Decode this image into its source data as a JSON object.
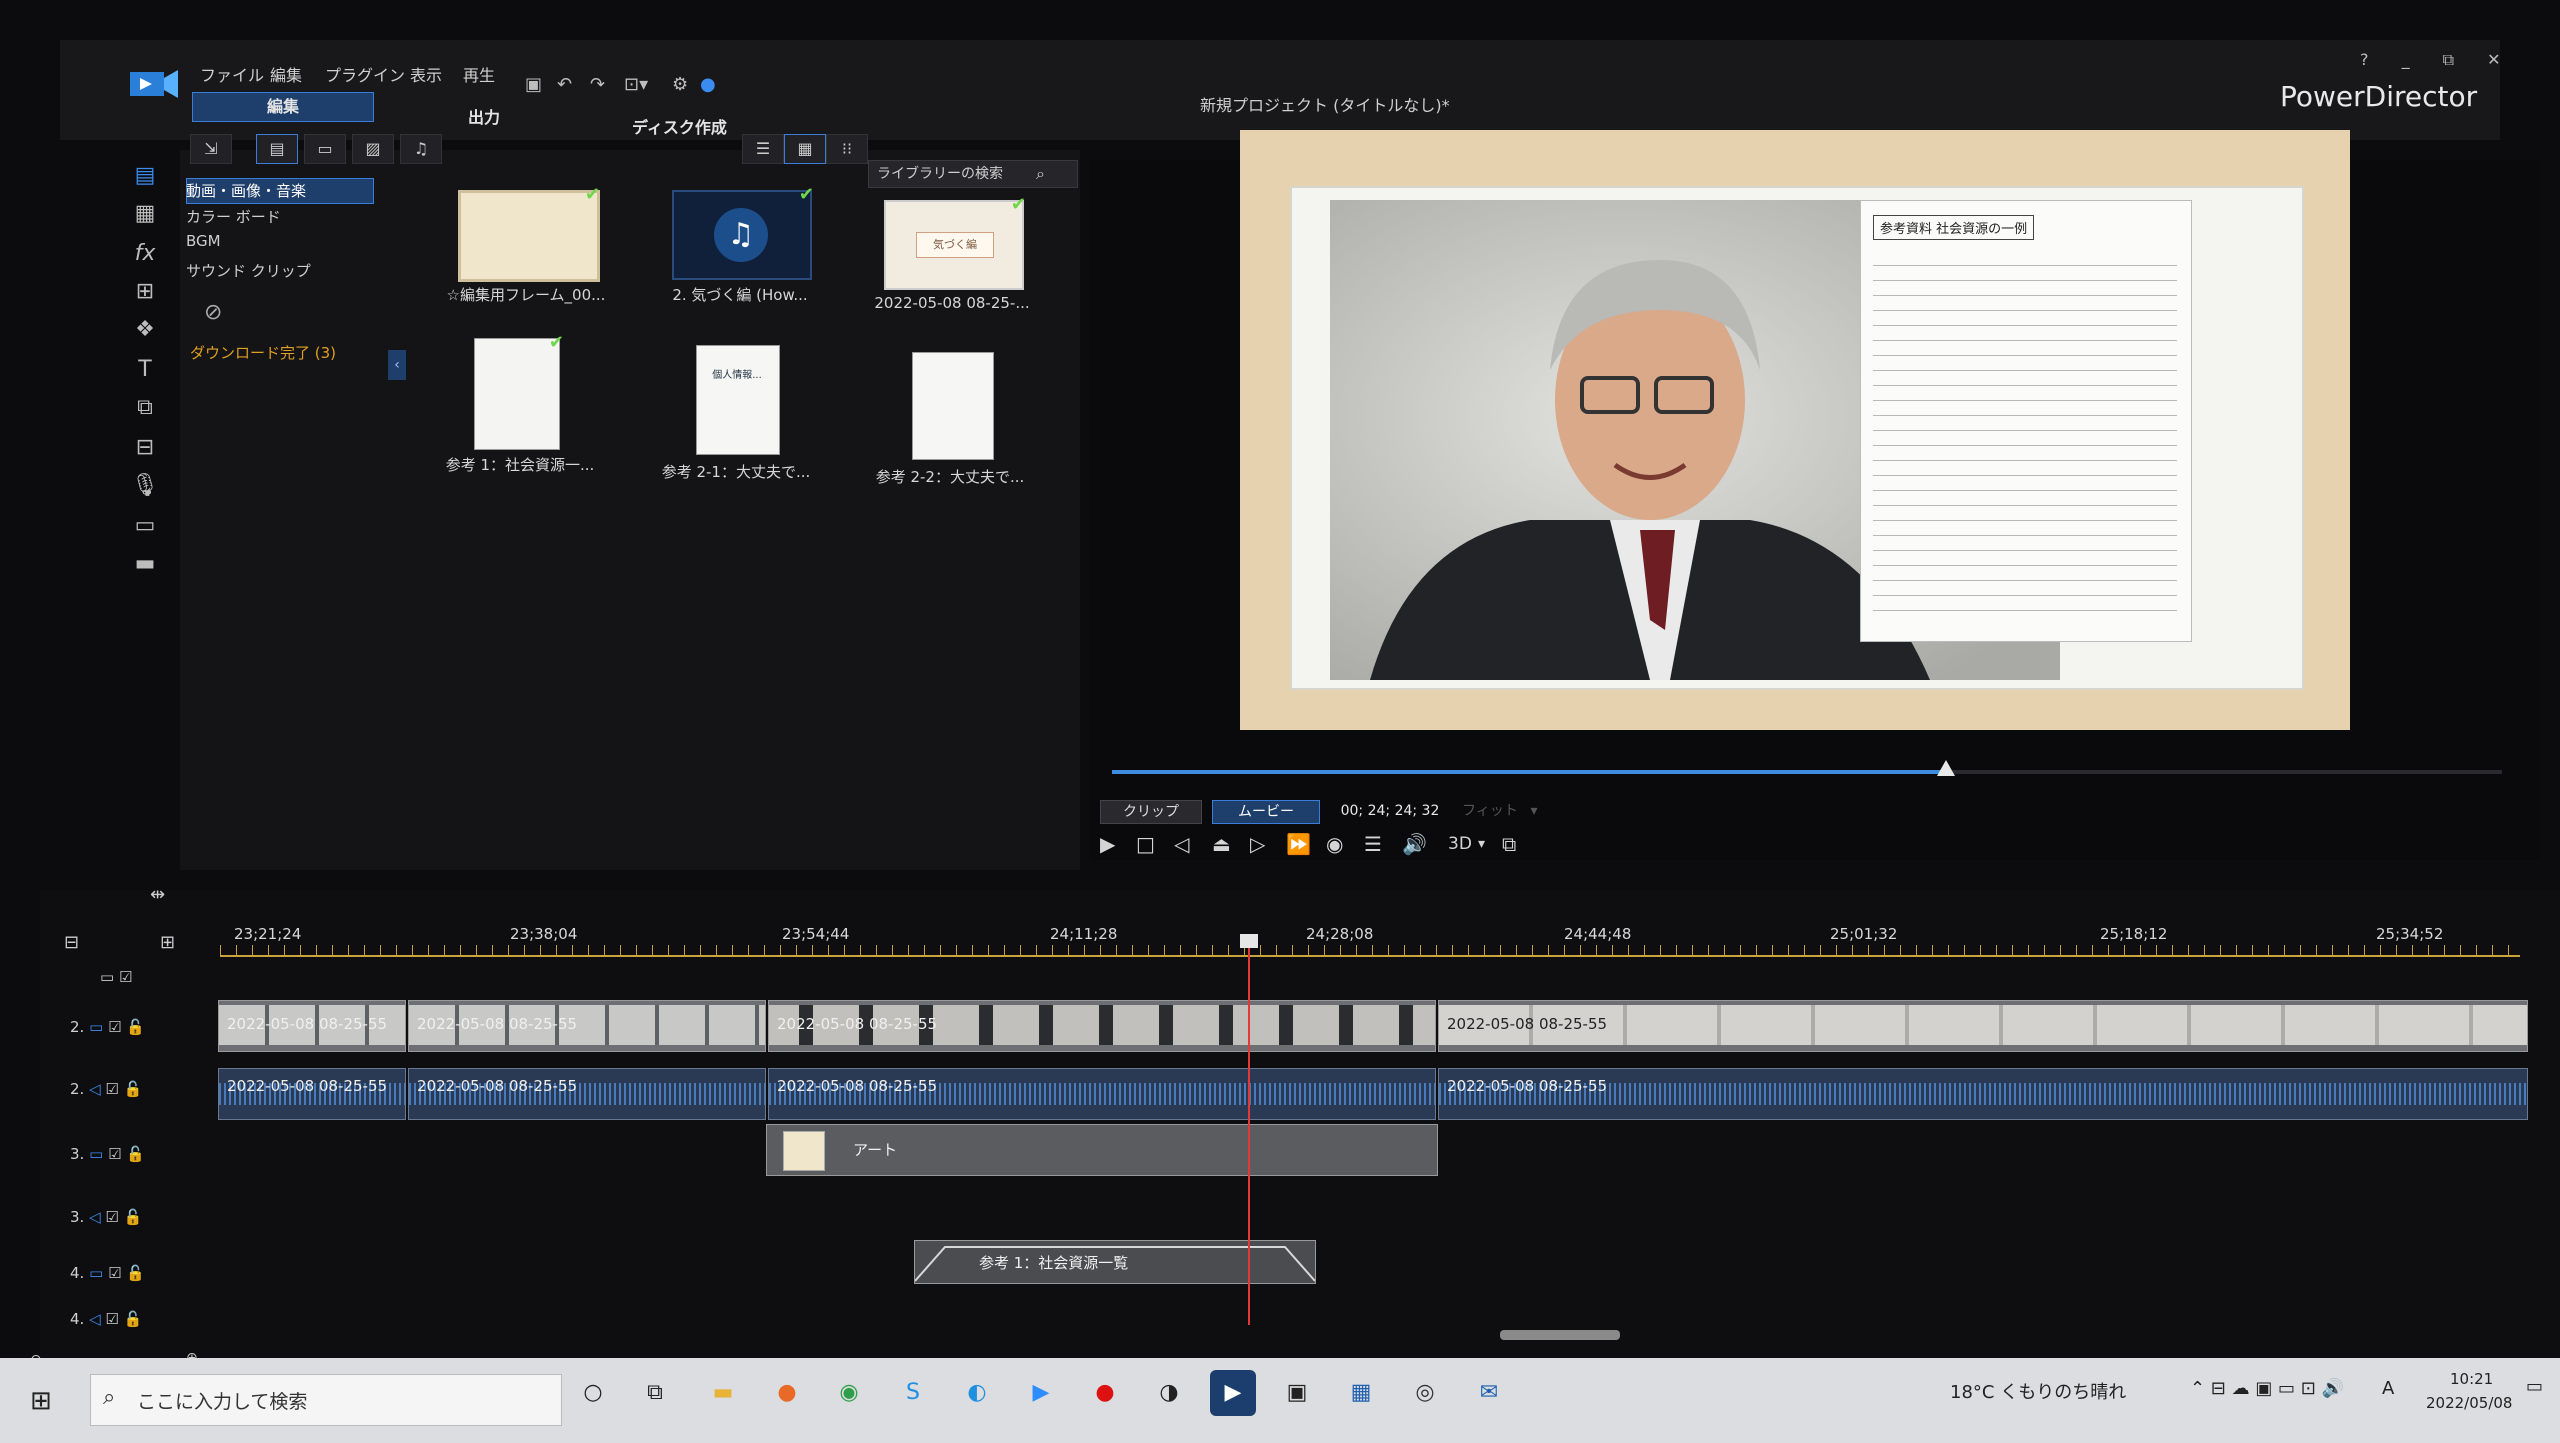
{
  "menu": [
    "ファイル",
    "編集",
    "プラグイン",
    "表示",
    "再生"
  ],
  "mode_tabs": {
    "edit": "編集",
    "output": "出力",
    "disc": "ディスク作成"
  },
  "project_title": "新規プロジェクト (タイトルなし)*",
  "app_name": "PowerDirector",
  "window_controls": "? _ ⧉ ✕",
  "library": {
    "search_placeholder": "ライブラリーの検索",
    "categories": [
      "動画・画像・音楽",
      "カラー ボード",
      "BGM",
      "サウンド クリップ"
    ],
    "download_done": "ダウンロード完了 (3)",
    "items": [
      {
        "caption": "☆編集用フレーム_00...",
        "checked": true
      },
      {
        "caption": "2. 気づく編 (How...",
        "checked": true
      },
      {
        "caption": "2022-05-08 08-25-...",
        "checked": true,
        "thumb_text": "気づく編"
      },
      {
        "caption": "参考 1：社会資源一...",
        "checked": true
      },
      {
        "caption": "参考 2-1：大丈夫で...",
        "checked": false,
        "thumb_text": "個人情報..."
      },
      {
        "caption": "参考 2-2：大丈夫で...",
        "checked": false
      }
    ]
  },
  "preview": {
    "document_title": "参考資料  社会資源の一例",
    "clip_btn": "クリップ",
    "movie_btn": "ムービー",
    "timecode": "00; 24; 24; 32",
    "fit": "フィット",
    "threed": "3D",
    "progress": 0.6
  },
  "timeline": {
    "ruler": [
      "23;21;24",
      "23;38;04",
      "23;54;44",
      "24;11;28",
      "24;28;08",
      "24;44;48",
      "25;01;32",
      "25;18;12",
      "25;34;52"
    ],
    "tracks": [
      {
        "label": "2.",
        "type": "video"
      },
      {
        "label": "2.",
        "type": "audio"
      },
      {
        "label": "3.",
        "type": "video"
      },
      {
        "label": "3.",
        "type": "audio"
      },
      {
        "label": "4.",
        "type": "video"
      },
      {
        "label": "4.",
        "type": "audio"
      }
    ],
    "video_clips": [
      "2022-05-08 08-25-55",
      "2022-05-08 08-25-55",
      "2022-05-08 08-25-55",
      "2022-05-08 08-25-55"
    ],
    "audio_clips": [
      "2022-05-08 08-25-55",
      "2022-05-08 08-25-55",
      "2022-05-08 08-25-55",
      "2022-05-08 08-25-55"
    ],
    "overlay_clip": "アート",
    "pip_clip": "参考 1：社会資源一覧"
  },
  "taskbar": {
    "search": "ここに入力して検索",
    "weather": "18°C  くもりのち晴れ",
    "ime": "A",
    "time": "10:21",
    "date": "2022/05/08"
  }
}
